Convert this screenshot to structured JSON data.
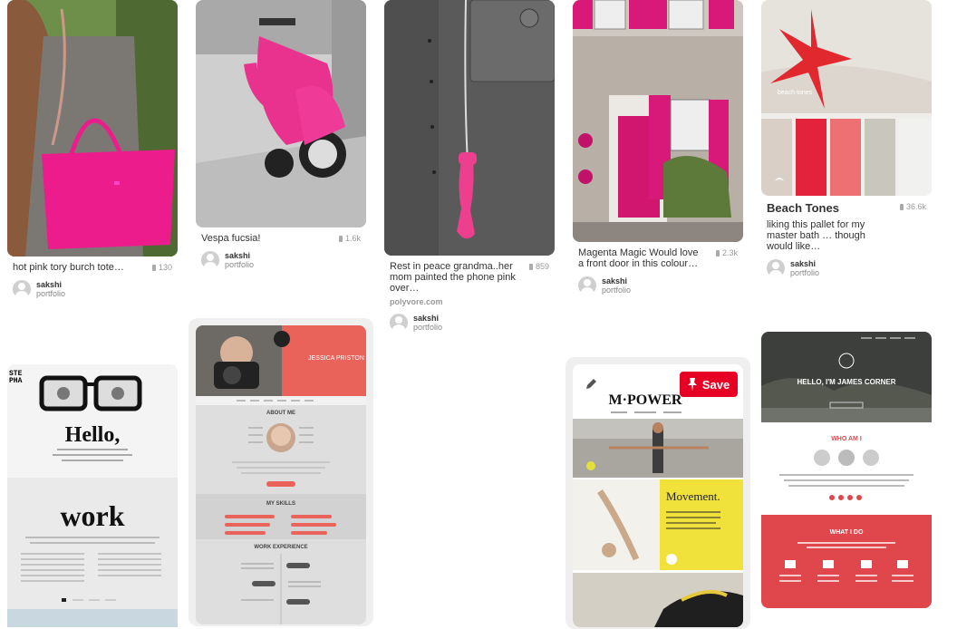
{
  "pins": [
    {
      "desc": "hot pink tory burch tote…",
      "repins": "130",
      "user": "sakshi",
      "board": "portfolio"
    },
    {
      "desc": "Vespa fucsia!",
      "repins": "1.6k",
      "user": "sakshi",
      "board": "portfolio"
    },
    {
      "desc": "Rest in peace grandma..her mom painted the phone pink over…",
      "repins": "859",
      "source": "polyvore.com",
      "user": "sakshi",
      "board": "portfolio"
    },
    {
      "desc": "Magenta Magic Would love a front door in this colour…",
      "repins": "2.3k",
      "user": "sakshi",
      "board": "portfolio"
    },
    {
      "title": "Beach Tones",
      "desc": "liking this pallet for my master bath … though would like…",
      "repins": "36.6k",
      "user": "sakshi",
      "board": "portfolio"
    }
  ],
  "hover_pin": {
    "save_label": "Save"
  },
  "image_text": {
    "hello": "Hello,",
    "work": "work",
    "jessica": "JESSICA PRISTON",
    "about": "ABOUT ME",
    "skills": "MY SKILLS",
    "experience": "WORK EXPERIENCE",
    "mpower": "M·POWER",
    "movement": "Movement.",
    "james": "HELLO, I'M JAMES CORNER",
    "whoami": "WHO AM I",
    "whatido": "WHAT I DO",
    "beach": "beach tones"
  }
}
